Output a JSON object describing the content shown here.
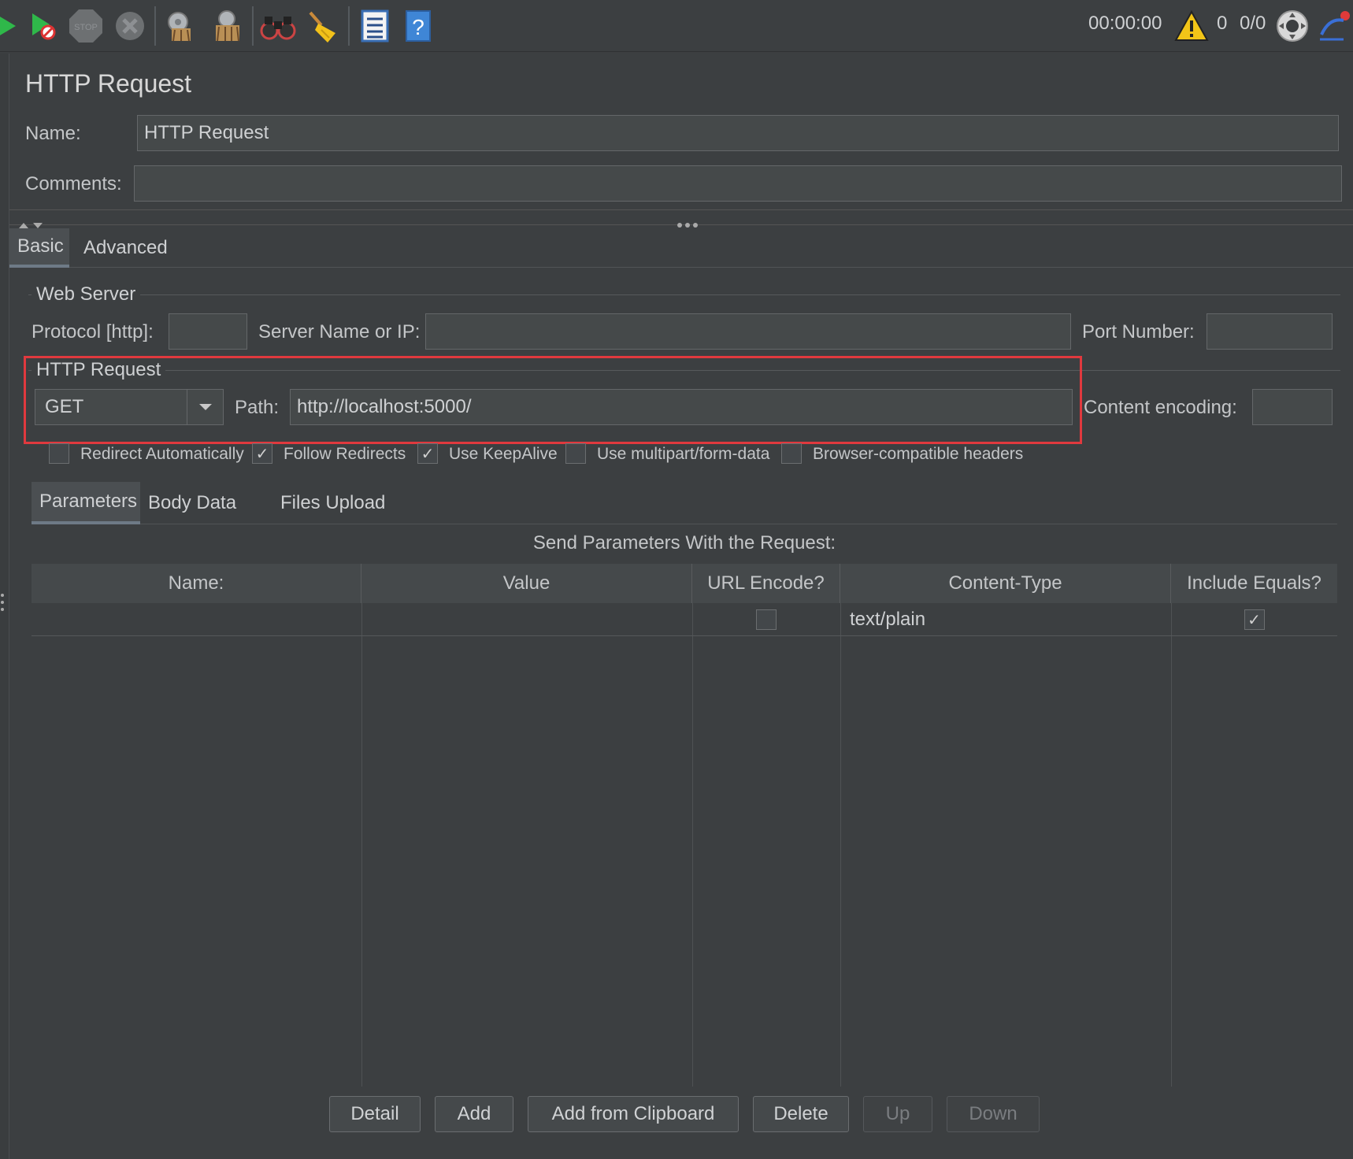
{
  "toolbar": {
    "timer": "00:00:00",
    "warning_count": "0",
    "thread_count": "0/0",
    "stop_text": "STOP"
  },
  "panel": {
    "title": "HTTP Request",
    "name_label": "Name:",
    "name_value": "HTTP Request",
    "comments_label": "Comments:",
    "comments_value": ""
  },
  "tabs": [
    "Basic",
    "Advanced"
  ],
  "web_server": {
    "group_title": "Web Server",
    "protocol_label": "Protocol [http]:",
    "protocol_value": "",
    "server_label": "Server Name or IP:",
    "server_value": "",
    "port_label": "Port Number:",
    "port_value": ""
  },
  "http_request": {
    "group_title": "HTTP Request",
    "method": "GET",
    "path_label": "Path:",
    "path_value": "http://localhost:5000/",
    "encoding_label": "Content encoding:",
    "encoding_value": ""
  },
  "options": [
    {
      "label": "Redirect Automatically",
      "checked": false
    },
    {
      "label": "Follow Redirects",
      "checked": true
    },
    {
      "label": "Use KeepAlive",
      "checked": true
    },
    {
      "label": "Use multipart/form-data",
      "checked": false
    },
    {
      "label": "Browser-compatible headers",
      "checked": false
    }
  ],
  "subtabs": [
    "Parameters",
    "Body Data",
    "Files Upload"
  ],
  "params": {
    "caption": "Send Parameters With the Request:",
    "columns": [
      "Name:",
      "Value",
      "URL Encode?",
      "Content-Type",
      "Include Equals?"
    ],
    "rows": [
      {
        "name": "",
        "value": "",
        "url_encode": false,
        "content_type": "text/plain",
        "include_equals": true
      }
    ]
  },
  "buttons": {
    "detail": "Detail",
    "add": "Add",
    "add_clipboard": "Add from Clipboard",
    "delete": "Delete",
    "up": "Up",
    "down": "Down"
  },
  "colors": {
    "background": "#3c3f41",
    "highlight_border": "#e0393e",
    "field": "#45494a"
  }
}
